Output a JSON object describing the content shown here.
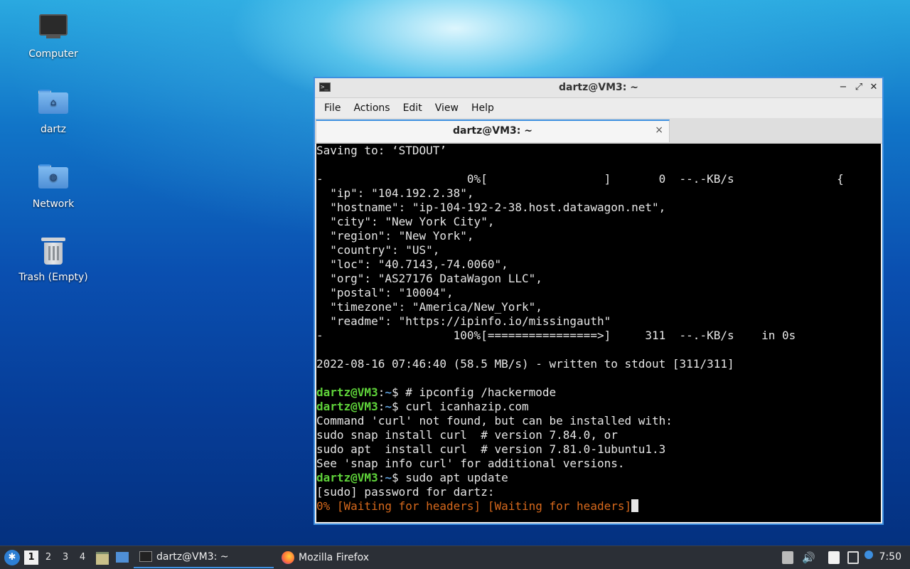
{
  "desktop": {
    "icons": [
      {
        "label": "Computer",
        "icon": "computer-icon"
      },
      {
        "label": "dartz",
        "icon": "home-folder-icon"
      },
      {
        "label": "Network",
        "icon": "network-folder-icon"
      },
      {
        "label": "Trash (Empty)",
        "icon": "trash-icon"
      }
    ]
  },
  "window": {
    "title": "dartz@VM3: ~",
    "menu": [
      "File",
      "Actions",
      "Edit",
      "View",
      "Help"
    ],
    "tab_label": "dartz@VM3: ~",
    "tab_close": "×",
    "controls": {
      "minimize": "−",
      "maximize": "⤢",
      "close": "✕"
    }
  },
  "terminal": {
    "lines": [
      "Saving to: ‘STDOUT’",
      "",
      "-                     0%[                 ]       0  --.-KB/s               {",
      "  \"ip\": \"104.192.2.38\",",
      "  \"hostname\": \"ip-104-192-2-38.host.datawagon.net\",",
      "  \"city\": \"New York City\",",
      "  \"region\": \"New York\",",
      "  \"country\": \"US\",",
      "  \"loc\": \"40.7143,-74.0060\",",
      "  \"org\": \"AS27176 DataWagon LLC\",",
      "  \"postal\": \"10004\",",
      "  \"timezone\": \"America/New_York\",",
      "  \"readme\": \"https://ipinfo.io/missingauth\"",
      "-                   100%[================>]     311  --.-KB/s    in 0s",
      "",
      "2022-08-16 07:46:40 (58.5 MB/s) - written to stdout [311/311]",
      ""
    ],
    "prompt_user": "dartz@VM3",
    "prompt_sep": ":",
    "prompt_path": "~",
    "prompt_end": "$ ",
    "cmd1": "# ipconfig /hackermode",
    "cmd2": "curl icanhazip.com",
    "curl_out": [
      "Command 'curl' not found, but can be installed with:",
      "sudo snap install curl  # version 7.84.0, or",
      "sudo apt  install curl  # version 7.81.0-1ubuntu1.3",
      "See 'snap info curl' for additional versions."
    ],
    "cmd3": "sudo apt update",
    "sudo_prompt": "[sudo] password for dartz:",
    "status_line": "0% [Waiting for headers] [Waiting for headers]"
  },
  "taskbar": {
    "workspaces": [
      "1",
      "2",
      "3",
      "4"
    ],
    "active_workspace": "1",
    "tasks": [
      {
        "label": "dartz@VM3: ~",
        "icon": "terminal-icon"
      },
      {
        "label": "Mozilla Firefox",
        "icon": "firefox-icon"
      }
    ],
    "clock": "7:50"
  }
}
